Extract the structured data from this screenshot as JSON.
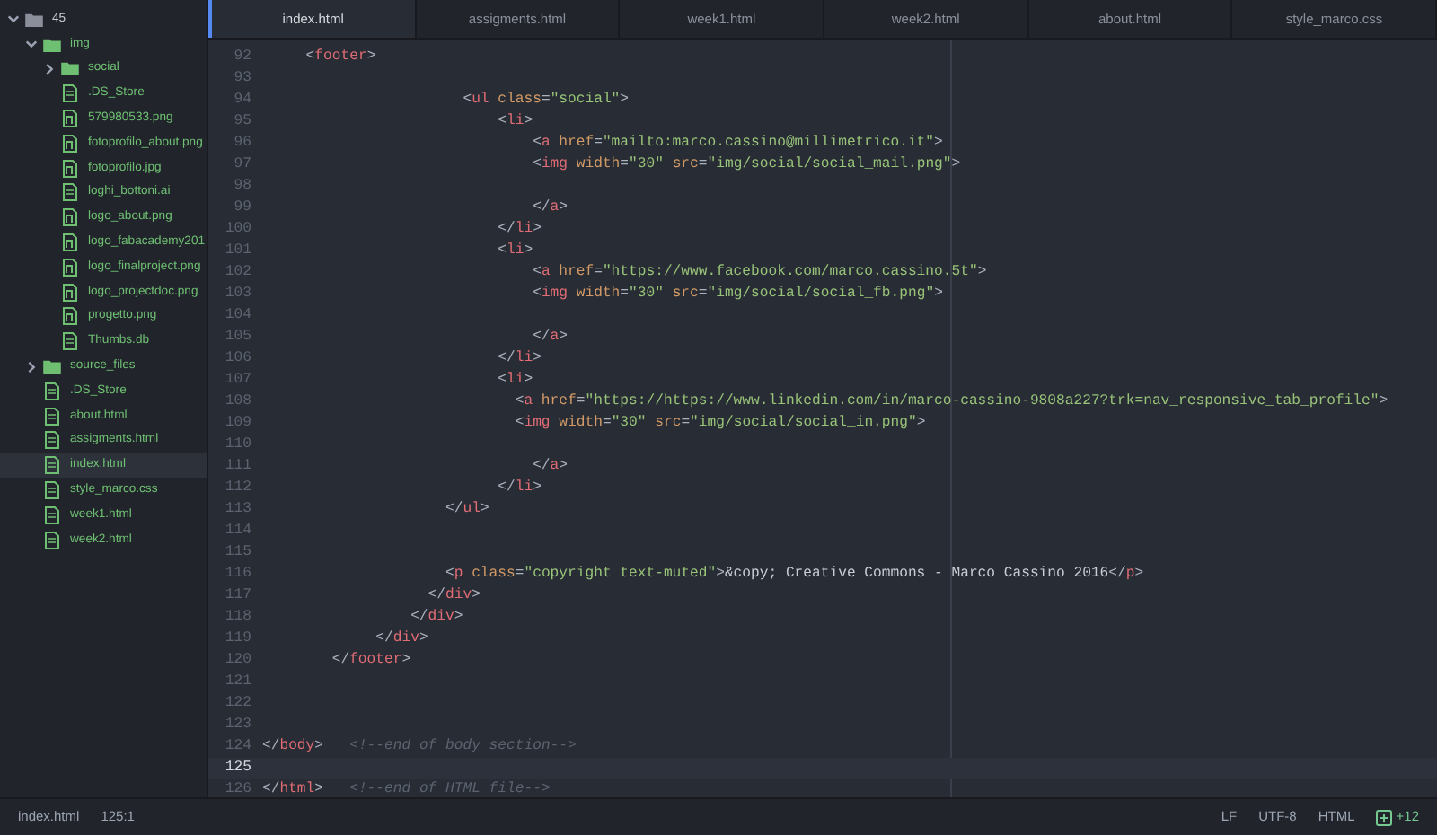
{
  "sidebar": {
    "tree": [
      {
        "kind": "folder",
        "name": "45",
        "expanded": true,
        "selected": false,
        "children": [
          {
            "kind": "folder",
            "name": "img",
            "expanded": true,
            "selected": false,
            "children": [
              {
                "kind": "folder",
                "name": "social",
                "expanded": false,
                "selected": false
              },
              {
                "kind": "file",
                "name": ".DS_Store",
                "selected": false
              },
              {
                "kind": "image",
                "name": "579980533.png",
                "selected": false
              },
              {
                "kind": "image",
                "name": "fotoprofilo_about.png",
                "selected": false
              },
              {
                "kind": "image",
                "name": "fotoprofilo.jpg",
                "selected": false
              },
              {
                "kind": "file",
                "name": "loghi_bottoni.ai",
                "selected": false
              },
              {
                "kind": "image",
                "name": "logo_about.png",
                "selected": false
              },
              {
                "kind": "image",
                "name": "logo_fabacademy201",
                "selected": false
              },
              {
                "kind": "image",
                "name": "logo_finalproject.png",
                "selected": false
              },
              {
                "kind": "image",
                "name": "logo_projectdoc.png",
                "selected": false
              },
              {
                "kind": "image",
                "name": "progetto.png",
                "selected": false
              },
              {
                "kind": "file",
                "name": "Thumbs.db",
                "selected": false
              }
            ]
          },
          {
            "kind": "folder",
            "name": "source_files",
            "expanded": false,
            "selected": false
          },
          {
            "kind": "file",
            "name": ".DS_Store",
            "selected": false
          },
          {
            "kind": "file",
            "name": "about.html",
            "selected": false
          },
          {
            "kind": "file",
            "name": "assigments.html",
            "selected": false
          },
          {
            "kind": "file",
            "name": "index.html",
            "selected": true
          },
          {
            "kind": "file",
            "name": "style_marco.css",
            "selected": false
          },
          {
            "kind": "file",
            "name": "week1.html",
            "selected": false
          },
          {
            "kind": "file",
            "name": "week2.html",
            "selected": false
          }
        ]
      }
    ]
  },
  "tabs": [
    {
      "label": "index.html",
      "selected": true
    },
    {
      "label": "assigments.html",
      "selected": false
    },
    {
      "label": "week1.html",
      "selected": false
    },
    {
      "label": "week2.html",
      "selected": false
    },
    {
      "label": "about.html",
      "selected": false
    },
    {
      "label": "style_marco.css",
      "selected": false
    }
  ],
  "editor": {
    "lines": [
      {
        "number": "92",
        "current": false,
        "tokens": [
          {
            "kind": "punct",
            "text": "     <"
          },
          {
            "kind": "tag",
            "text": "footer"
          },
          {
            "kind": "punct",
            "text": ">"
          }
        ]
      },
      {
        "number": "93",
        "current": false
      },
      {
        "number": "94",
        "current": false,
        "tokens": [
          {
            "kind": "punct",
            "text": "                       <"
          },
          {
            "kind": "tag",
            "text": "ul"
          },
          {
            "kind": "attr",
            "text": " class"
          },
          {
            "kind": "punct",
            "text": "="
          },
          {
            "kind": "string",
            "text": "\"social\""
          },
          {
            "kind": "punct",
            "text": ">"
          }
        ]
      },
      {
        "number": "95",
        "current": false,
        "tokens": [
          {
            "kind": "punct",
            "text": "                           <"
          },
          {
            "kind": "tag",
            "text": "li"
          },
          {
            "kind": "punct",
            "text": ">"
          }
        ]
      },
      {
        "number": "96",
        "current": false,
        "tokens": [
          {
            "kind": "punct",
            "text": "                               <"
          },
          {
            "kind": "tag",
            "text": "a"
          },
          {
            "kind": "attr",
            "text": " href"
          },
          {
            "kind": "punct",
            "text": "="
          },
          {
            "kind": "string",
            "text": "\"mailto:marco.cassino@millimetrico.it\""
          },
          {
            "kind": "punct",
            "text": ">"
          }
        ]
      },
      {
        "number": "97",
        "current": false,
        "tokens": [
          {
            "kind": "punct",
            "text": "                               <"
          },
          {
            "kind": "tag",
            "text": "img"
          },
          {
            "kind": "attr",
            "text": " width"
          },
          {
            "kind": "punct",
            "text": "="
          },
          {
            "kind": "string",
            "text": "\"30\""
          },
          {
            "kind": "attr",
            "text": " src"
          },
          {
            "kind": "punct",
            "text": "="
          },
          {
            "kind": "string",
            "text": "\"img/social/social_mail.png\""
          },
          {
            "kind": "punct",
            "text": ">"
          }
        ]
      },
      {
        "number": "98",
        "current": false
      },
      {
        "number": "99",
        "current": false,
        "tokens": [
          {
            "kind": "punct",
            "text": "                               </"
          },
          {
            "kind": "tag",
            "text": "a"
          },
          {
            "kind": "punct",
            "text": ">"
          }
        ]
      },
      {
        "number": "100",
        "current": false,
        "tokens": [
          {
            "kind": "punct",
            "text": "                           </"
          },
          {
            "kind": "tag",
            "text": "li"
          },
          {
            "kind": "punct",
            "text": ">"
          }
        ]
      },
      {
        "number": "101",
        "current": false,
        "tokens": [
          {
            "kind": "punct",
            "text": "                           <"
          },
          {
            "kind": "tag",
            "text": "li"
          },
          {
            "kind": "punct",
            "text": ">"
          }
        ]
      },
      {
        "number": "102",
        "current": false,
        "tokens": [
          {
            "kind": "punct",
            "text": "                               <"
          },
          {
            "kind": "tag",
            "text": "a"
          },
          {
            "kind": "attr",
            "text": " href"
          },
          {
            "kind": "punct",
            "text": "="
          },
          {
            "kind": "string",
            "text": "\"https://www.facebook.com/marco.cassino.5t\""
          },
          {
            "kind": "punct",
            "text": ">"
          }
        ]
      },
      {
        "number": "103",
        "current": false,
        "tokens": [
          {
            "kind": "punct",
            "text": "                               <"
          },
          {
            "kind": "tag",
            "text": "img"
          },
          {
            "kind": "attr",
            "text": " width"
          },
          {
            "kind": "punct",
            "text": "="
          },
          {
            "kind": "string",
            "text": "\"30\""
          },
          {
            "kind": "attr",
            "text": " src"
          },
          {
            "kind": "punct",
            "text": "="
          },
          {
            "kind": "string",
            "text": "\"img/social/social_fb.png\""
          },
          {
            "kind": "punct",
            "text": ">"
          }
        ]
      },
      {
        "number": "104",
        "current": false
      },
      {
        "number": "105",
        "current": false,
        "tokens": [
          {
            "kind": "punct",
            "text": "                               </"
          },
          {
            "kind": "tag",
            "text": "a"
          },
          {
            "kind": "punct",
            "text": ">"
          }
        ]
      },
      {
        "number": "106",
        "current": false,
        "tokens": [
          {
            "kind": "punct",
            "text": "                           </"
          },
          {
            "kind": "tag",
            "text": "li"
          },
          {
            "kind": "punct",
            "text": ">"
          }
        ]
      },
      {
        "number": "107",
        "current": false,
        "tokens": [
          {
            "kind": "punct",
            "text": "                           <"
          },
          {
            "kind": "tag",
            "text": "li"
          },
          {
            "kind": "punct",
            "text": ">"
          }
        ]
      },
      {
        "number": "108",
        "current": false,
        "tokens": [
          {
            "kind": "punct",
            "text": "                             <"
          },
          {
            "kind": "tag",
            "text": "a"
          },
          {
            "kind": "attr",
            "text": " href"
          },
          {
            "kind": "punct",
            "text": "="
          },
          {
            "kind": "string",
            "text": "\"https://https://www.linkedin.com/in/marco-cassino-9808a227?trk=nav_responsive_tab_profile\""
          },
          {
            "kind": "punct",
            "text": ">"
          }
        ]
      },
      {
        "number": "109",
        "current": false,
        "tokens": [
          {
            "kind": "punct",
            "text": "                             <"
          },
          {
            "kind": "tag",
            "text": "img"
          },
          {
            "kind": "attr",
            "text": " width"
          },
          {
            "kind": "punct",
            "text": "="
          },
          {
            "kind": "string",
            "text": "\"30\""
          },
          {
            "kind": "attr",
            "text": " src"
          },
          {
            "kind": "punct",
            "text": "="
          },
          {
            "kind": "string",
            "text": "\"img/social/social_in.png\""
          },
          {
            "kind": "punct",
            "text": ">"
          }
        ]
      },
      {
        "number": "110",
        "current": false
      },
      {
        "number": "111",
        "current": false,
        "tokens": [
          {
            "kind": "punct",
            "text": "                               </"
          },
          {
            "kind": "tag",
            "text": "a"
          },
          {
            "kind": "punct",
            "text": ">"
          }
        ]
      },
      {
        "number": "112",
        "current": false,
        "tokens": [
          {
            "kind": "punct",
            "text": "                           </"
          },
          {
            "kind": "tag",
            "text": "li"
          },
          {
            "kind": "punct",
            "text": ">"
          }
        ]
      },
      {
        "number": "113",
        "current": false,
        "tokens": [
          {
            "kind": "punct",
            "text": "                     </"
          },
          {
            "kind": "tag",
            "text": "ul"
          },
          {
            "kind": "punct",
            "text": ">"
          }
        ]
      },
      {
        "number": "114",
        "current": false
      },
      {
        "number": "115",
        "current": false
      },
      {
        "number": "116",
        "current": false,
        "tokens": [
          {
            "kind": "punct",
            "text": "                     <"
          },
          {
            "kind": "tag",
            "text": "p"
          },
          {
            "kind": "attr",
            "text": " class"
          },
          {
            "kind": "punct",
            "text": "="
          },
          {
            "kind": "string",
            "text": "\"copyright text-muted\""
          },
          {
            "kind": "punct",
            "text": ">"
          },
          {
            "kind": "text",
            "text": "&copy; Creative Commons - Marco Cassino 2016"
          },
          {
            "kind": "punct",
            "text": "</"
          },
          {
            "kind": "tag",
            "text": "p"
          },
          {
            "kind": "punct",
            "text": ">"
          }
        ]
      },
      {
        "number": "117",
        "current": false,
        "tokens": [
          {
            "kind": "punct",
            "text": "                   </"
          },
          {
            "kind": "tag",
            "text": "div"
          },
          {
            "kind": "punct",
            "text": ">"
          }
        ]
      },
      {
        "number": "118",
        "current": false,
        "tokens": [
          {
            "kind": "punct",
            "text": "                 </"
          },
          {
            "kind": "tag",
            "text": "div"
          },
          {
            "kind": "punct",
            "text": ">"
          }
        ]
      },
      {
        "number": "119",
        "current": false,
        "tokens": [
          {
            "kind": "punct",
            "text": "             </"
          },
          {
            "kind": "tag",
            "text": "div"
          },
          {
            "kind": "punct",
            "text": ">"
          }
        ]
      },
      {
        "number": "120",
        "current": false,
        "tokens": [
          {
            "kind": "punct",
            "text": "        </"
          },
          {
            "kind": "tag",
            "text": "footer"
          },
          {
            "kind": "punct",
            "text": ">"
          }
        ]
      },
      {
        "number": "121",
        "current": false
      },
      {
        "number": "122",
        "current": false
      },
      {
        "number": "123",
        "current": false
      },
      {
        "number": "124",
        "current": false,
        "tokens": [
          {
            "kind": "punct",
            "text": "</"
          },
          {
            "kind": "tag",
            "text": "body"
          },
          {
            "kind": "punct",
            "text": ">   "
          },
          {
            "kind": "comment",
            "text": "<!--end of body section-->"
          }
        ]
      },
      {
        "number": "125",
        "current": true
      },
      {
        "number": "126",
        "current": false,
        "tokens": [
          {
            "kind": "punct",
            "text": "</"
          },
          {
            "kind": "tag",
            "text": "html"
          },
          {
            "kind": "punct",
            "text": ">   "
          },
          {
            "kind": "comment",
            "text": "<!--end of HTML file-->"
          }
        ]
      }
    ]
  },
  "status_bar": {
    "file": "index.html",
    "position": "125:1",
    "line_ending": "LF",
    "encoding": "UTF-8",
    "grammar": "HTML",
    "git_changes": "+12"
  }
}
